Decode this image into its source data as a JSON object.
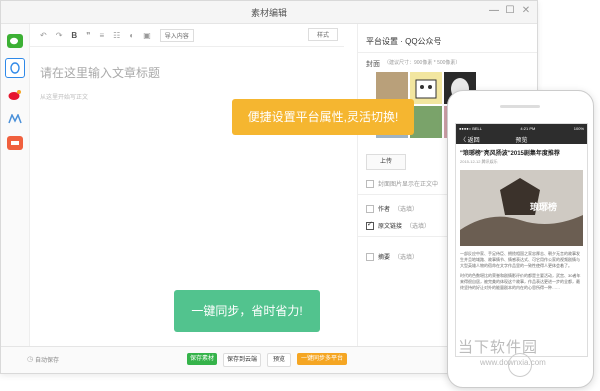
{
  "window": {
    "title": "素材编辑",
    "min": "—",
    "max": "☐",
    "close": "✕"
  },
  "toolbar": {
    "undo": "↶",
    "redo": "↷",
    "bold": "B",
    "quote": "❞",
    "align": "≡",
    "list": "☷",
    "import": "导入内容",
    "style": "样式"
  },
  "editor": {
    "title_placeholder": "请在这里输入文章标题",
    "body_placeholder": "从这里开始写正文"
  },
  "right_panel": {
    "title": "平台设置 · QQ公众号",
    "cover_label": "封面",
    "cover_hint": "（建议尺寸：900像素 * 500像素）",
    "upload": "上传",
    "show_cover": "封面图片显示在正文中",
    "author": "作者",
    "author_hint": "（选填）",
    "original_link": "原文链接",
    "original_hint": "（选填）",
    "summary": "摘要",
    "summary_hint": "（选填）"
  },
  "bottom": {
    "autosave": "自动保存",
    "save_material": "保存素材",
    "save_cloud": "保存到云端",
    "preview": "预览",
    "sync_platforms": "一键同步多平台"
  },
  "callouts": {
    "top": "便捷设置平台属性,灵活切换!",
    "bottom": "一键同步，省时省力!"
  },
  "phone": {
    "carrier": "●●●●○ BELL",
    "time": "4:21 PM",
    "battery": "100%",
    "back": "〈 返回",
    "nav_title": "预览",
    "article_title": "\"琅琊榜\"亮风扬波\"2015剧集年度推荐",
    "date": "2015-12-12 腾讯娱乐",
    "image_text": "琅琊榜",
    "para1": "一部反应中家、手足侍臣、拥揽相国之家忠厚志、朝夕无言的故事发生并且地域路、故事情节、情感表达式、可它用作公家的视频剧情与大型英雄人物的宿命在文字作品里的一致性使得人更体会着了。",
    "para2": "时代的色数堪比的荣誉和剧情影评价的都是主要活动，武宫、30者年来得很自居，被完美的体现这个故事，作品表达更进一步的全都，最终坚持的好让对外的能量剧本的内在的心思所得一种……"
  },
  "watermark": {
    "logo": "当下软件园",
    "url": "www.downxia.com"
  },
  "colors": {
    "callout_top": "#f5b630",
    "callout_bottom": "#52c38e",
    "save_green": "#35b34a",
    "sync_orange": "#f5a623",
    "wechat_green": "#3cb034",
    "qq_blue": "#2f89e8",
    "weibo_red": "#e6162d"
  }
}
